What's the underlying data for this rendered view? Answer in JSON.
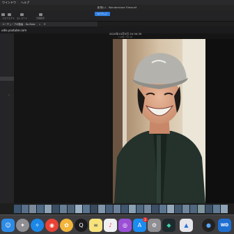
{
  "menubar": {
    "items": [
      "ウインドウ",
      "ヘルプ"
    ]
  },
  "window": {
    "title": "新規ｾｯﾄ - Wondershare Filmora9",
    "upgrade_label": "ｱｯﾌﾟｸﾞﾚｰﾄﾞ"
  },
  "toolbar": {
    "items": [
      "ト",
      "エフェクト",
      "エレメント",
      "分割表示"
    ]
  },
  "tabs": [
    {
      "label": "ユーチューブの動画 - YouTube",
      "close": "×"
    }
  ],
  "tab_add": "+",
  "url_text": "udio.youtube.com",
  "preview": {
    "timestamp": "2020年10月9日 20:30:39",
    "subinfo": "1,944 / 52.1C"
  },
  "dock": {
    "apps": [
      {
        "name": "finder",
        "glyph": "☺"
      },
      {
        "name": "launchpad",
        "glyph": "✦"
      },
      {
        "name": "safari",
        "glyph": "✧"
      },
      {
        "name": "chrome",
        "glyph": "◉"
      },
      {
        "name": "photos-app",
        "glyph": "✿"
      },
      {
        "name": "quicktime",
        "glyph": "Q"
      },
      {
        "name": "notes",
        "glyph": "≡"
      },
      {
        "name": "music",
        "glyph": "♪"
      },
      {
        "name": "podcasts",
        "glyph": "◎"
      },
      {
        "name": "app-store",
        "glyph": "A",
        "badge": "2"
      },
      {
        "name": "system-preferences",
        "glyph": "⚙"
      },
      {
        "name": "filmora",
        "glyph": "◆"
      },
      {
        "name": "keynote",
        "glyph": "▲"
      },
      {
        "name": "camera",
        "glyph": "●"
      },
      {
        "name": "wd-drive",
        "glyph": "WD"
      }
    ]
  }
}
